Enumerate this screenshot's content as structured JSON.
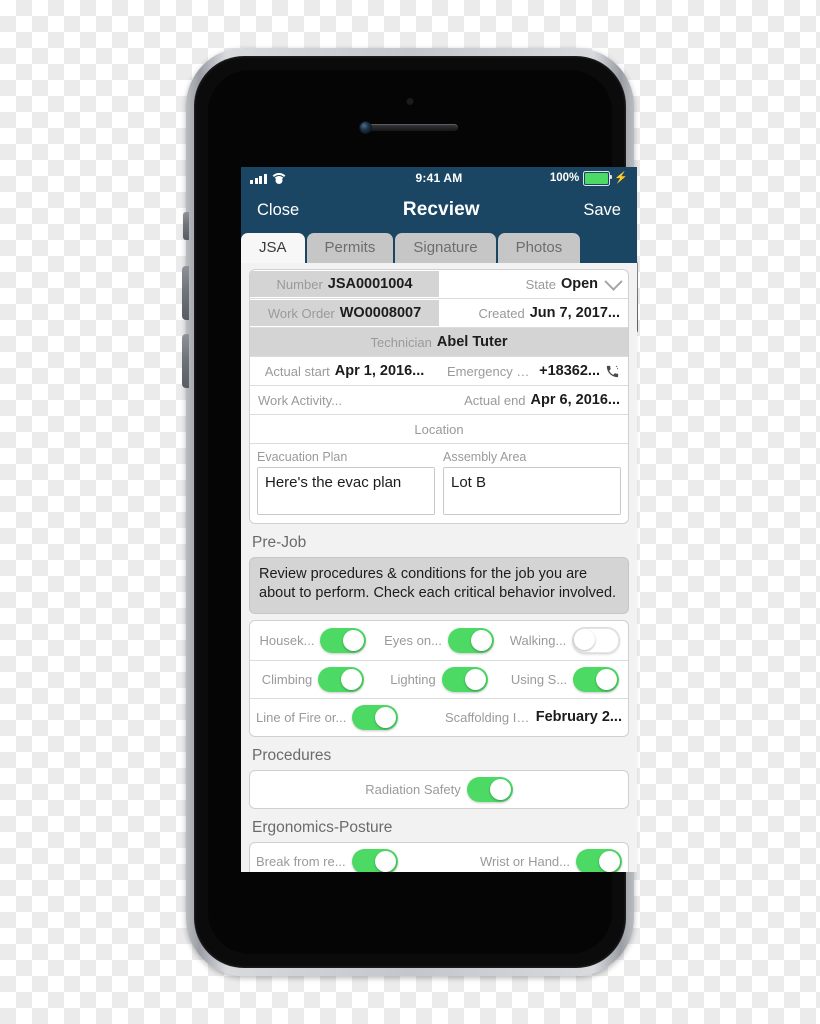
{
  "status_bar": {
    "signal_icon": "signal-bars-icon",
    "wifi_icon": "wifi-icon",
    "time": "9:41 AM",
    "battery_percent": "100%",
    "battery_icon": "battery-full-icon",
    "charging_icon": "lightning-bolt-icon"
  },
  "nav": {
    "close_label": "Close",
    "title": "Recview",
    "save_label": "Save"
  },
  "tabs": [
    {
      "label": "JSA",
      "active": true
    },
    {
      "label": "Permits",
      "active": false
    },
    {
      "label": "Signature",
      "active": false
    },
    {
      "label": "Photos",
      "active": false
    }
  ],
  "details": {
    "number_label": "Number",
    "number_value": "JSA0001004",
    "state_label": "State",
    "state_value": "Open",
    "state_chevron": "chevron-down-icon",
    "work_order_label": "Work Order",
    "work_order_value": "WO0008007",
    "created_label": "Created",
    "created_value": "Jun 7, 2017...",
    "technician_label": "Technician",
    "technician_value": "Abel Tuter",
    "actual_start_label": "Actual start",
    "actual_start_value": "Apr 1, 2016...",
    "emergency_phone_label": "Emergency P...",
    "emergency_phone_value": "+18362...",
    "phone_icon": "phone-call-icon",
    "work_activity_label": "Work Activity...",
    "actual_end_label": "Actual end",
    "actual_end_value": "Apr 6, 2016...",
    "location_label": "Location",
    "evacuation_plan_label": "Evacuation Plan",
    "evacuation_plan_value": "Here's the evac plan",
    "assembly_area_label": "Assembly Area",
    "assembly_area_value": "Lot B"
  },
  "prejob": {
    "section_title": "Pre-Job",
    "instructions": "Review procedures & conditions for the job you are about to perform. Check each critical behavior involved.",
    "rows": [
      [
        {
          "label": "Housek...",
          "type": "toggle",
          "on": true
        },
        {
          "label": "Eyes on...",
          "type": "toggle",
          "on": true
        },
        {
          "label": "Walking...",
          "type": "toggle",
          "on": false
        }
      ],
      [
        {
          "label": "Climbing",
          "type": "toggle",
          "on": true
        },
        {
          "label": "Lighting",
          "type": "toggle",
          "on": true
        },
        {
          "label": "Using S...",
          "type": "toggle",
          "on": true
        }
      ],
      [
        {
          "label": "Line of Fire or...",
          "type": "toggle",
          "on": true
        },
        {
          "label": "Scaffolding In...",
          "type": "value",
          "value": "February 2..."
        }
      ]
    ]
  },
  "procedures": {
    "section_title": "Procedures",
    "rows": [
      [
        {
          "label": "Radiation Safety",
          "type": "toggle",
          "on": true
        }
      ]
    ]
  },
  "ergonomics": {
    "section_title": "Ergonomics-Posture",
    "rows": [
      [
        {
          "label": "Break from re...",
          "type": "toggle",
          "on": true
        },
        {
          "label": "Wrist or Hand...",
          "type": "toggle",
          "on": true
        }
      ]
    ]
  },
  "colors": {
    "nav_blue": "#1b4663",
    "toggle_green": "#4cd964",
    "page_background": "#f2f2f2",
    "shaded_cell": "#d4d4d4"
  }
}
